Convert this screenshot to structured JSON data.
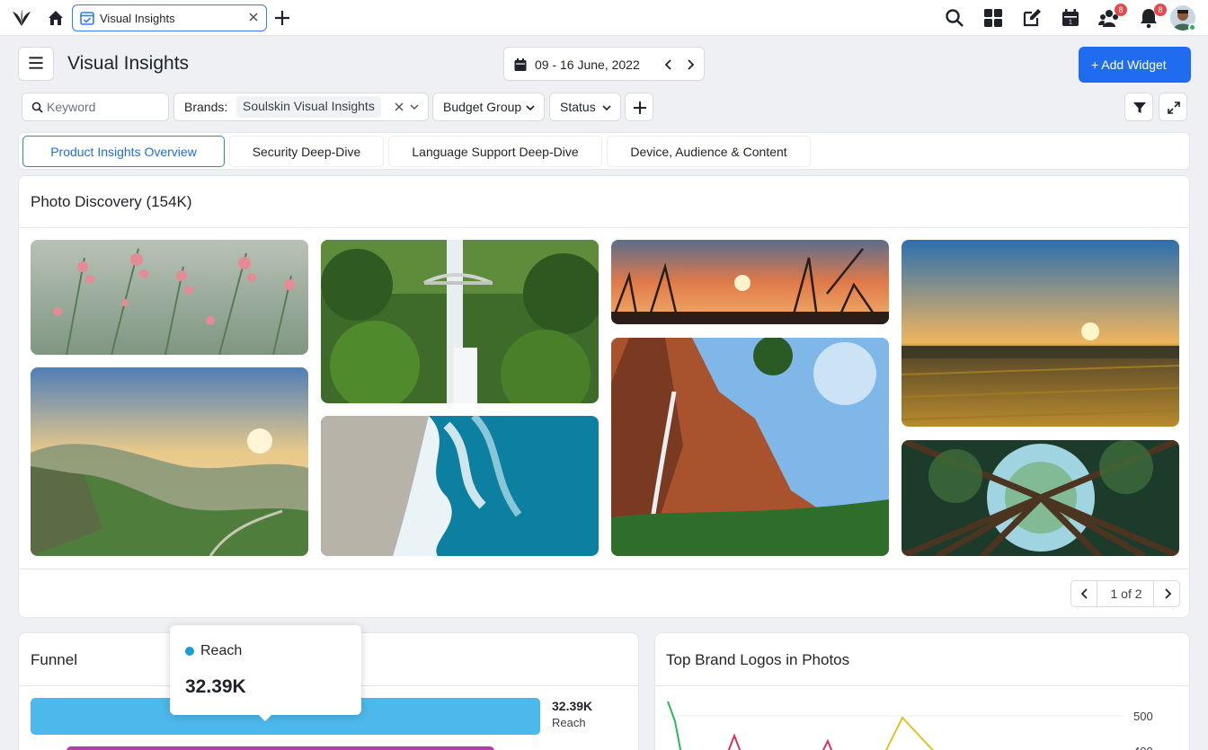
{
  "topbar": {
    "tab_title": "Visual Insights",
    "notification_badges": {
      "people": "8",
      "bell": "8"
    }
  },
  "header": {
    "page_title": "Visual Insights",
    "date_range": "09 - 16 June, 2022",
    "add_widget_label": "+ Add Widget"
  },
  "filters": {
    "keyword_placeholder": "Keyword",
    "brands_label": "Brands:",
    "brands_value": "Soulskin Visual Insights",
    "budget_group_label": "Budget Group",
    "status_label": "Status"
  },
  "dashboard_tabs": [
    {
      "label": "Product Insights Overview",
      "active": true
    },
    {
      "label": "Security Deep-Dive",
      "active": false
    },
    {
      "label": "Language Support Deep-Dive",
      "active": false
    },
    {
      "label": "Device, Audience & Content",
      "active": false
    }
  ],
  "photo_widget": {
    "title": "Photo Discovery (154K)",
    "photos": [
      "pink-wildflowers",
      "waterfall-bridge",
      "sunset-branches",
      "wheat-field-sunset",
      "green-valley-sunrise",
      "ocean-waves",
      "red-canyon-waterfall",
      "forest-canopy"
    ],
    "pager_text": "1 of 2"
  },
  "funnel_widget": {
    "title": "Funnel",
    "bars": [
      {
        "name": "Reach",
        "value": "32.39K",
        "fraction": 1.0,
        "color": "#4db8ec"
      },
      {
        "name": "",
        "value": "",
        "fraction": 0.84,
        "color": "#b03fa8"
      }
    ],
    "tooltip": {
      "series": "Reach",
      "value": "32.39K",
      "dot_color": "#1e9bd7"
    }
  },
  "logos_widget": {
    "title": "Top Brand Logos in Photos",
    "y_ticks": [
      "500",
      "400"
    ]
  },
  "colors": {
    "accent": "#1f6cf0",
    "badge": "#e5484d"
  }
}
